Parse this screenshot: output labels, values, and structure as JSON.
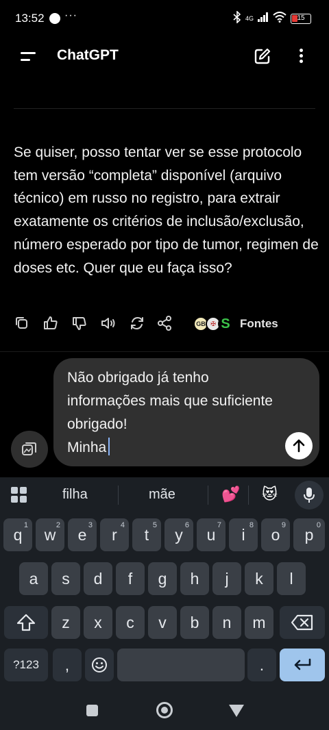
{
  "status_bar": {
    "time": "13:52",
    "notification_icons": [
      "messenger-icon",
      "more-dots-icon"
    ],
    "network": "4G",
    "battery": "15",
    "icons": [
      "bluetooth-icon",
      "signal-icon",
      "wifi-icon",
      "battery-icon"
    ]
  },
  "header": {
    "title": "ChatGPT",
    "icons": [
      "menu-icon",
      "new-chat-icon",
      "more-options-icon"
    ]
  },
  "conversation": {
    "assistant_message": "Se quiser, posso tentar ver se esse protocolo tem versão “completa” disponível (arquivo técnico) em russo no registro, para extrair exatamente os critérios de inclusão/exclusão, número esperado por tipo de tumor, regimen de doses etc. Quer que eu faça isso?",
    "actions": [
      "copy-icon",
      "thumbs-up-icon",
      "thumbs-down-icon",
      "read-aloud-icon",
      "regenerate-icon",
      "share-icon"
    ],
    "sources_label": "Fontes",
    "source_badges": [
      "GB",
      "✠",
      "S"
    ]
  },
  "composer": {
    "value": "Não obrigado já tenho informações mais que suficiente obrigado!\nMinha",
    "send_icon": "arrow-up-icon",
    "attach_icon": "attach-icon"
  },
  "keyboard": {
    "suggestions": [
      "filha",
      "mãe"
    ],
    "emoji_suggestions": [
      "💕",
      "😻"
    ],
    "row1": [
      {
        "key": "q",
        "hint": "1"
      },
      {
        "key": "w",
        "hint": "2"
      },
      {
        "key": "e",
        "hint": "3"
      },
      {
        "key": "r",
        "hint": "4"
      },
      {
        "key": "t",
        "hint": "5"
      },
      {
        "key": "y",
        "hint": "6"
      },
      {
        "key": "u",
        "hint": "7"
      },
      {
        "key": "i",
        "hint": "8"
      },
      {
        "key": "o",
        "hint": "9"
      },
      {
        "key": "p",
        "hint": "0"
      }
    ],
    "row2": [
      "a",
      "s",
      "d",
      "f",
      "g",
      "h",
      "j",
      "k",
      "l"
    ],
    "row3": [
      "z",
      "x",
      "c",
      "v",
      "b",
      "n",
      "m"
    ],
    "symbols_label": "?123",
    "comma": ",",
    "period": ".",
    "accent_color": "#9fc5ec",
    "key_color": "#3a3f46"
  },
  "nav_bar": {
    "icons": [
      "recents-icon",
      "home-icon",
      "back-icon"
    ]
  }
}
